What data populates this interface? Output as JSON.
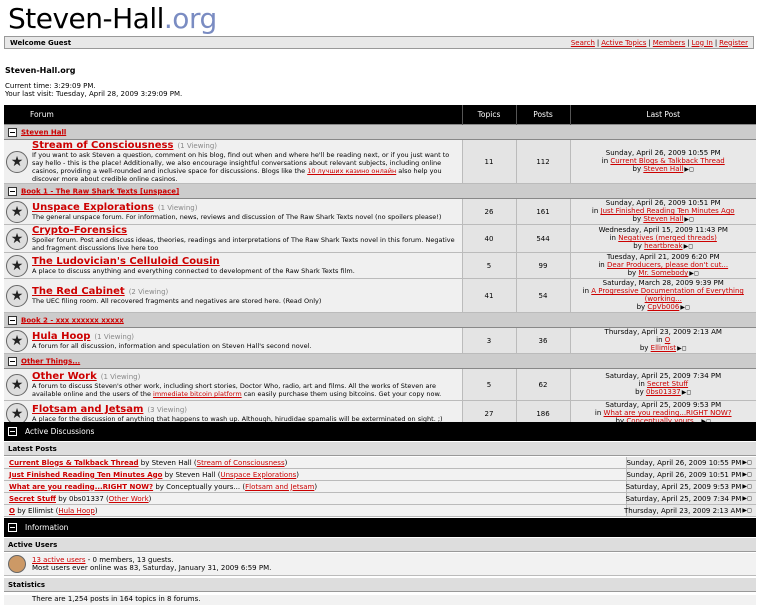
{
  "logo": {
    "part1": "Steven-Hall",
    "part2": ".org"
  },
  "welcome": "Welcome Guest",
  "toplinks": [
    "Search",
    "Active Topics",
    "Members",
    "Log In",
    "Register"
  ],
  "site_name": "Steven-Hall.org",
  "current_time": "Current time: 3:29:09 PM.",
  "last_visit": "Your last visit: Tuesday, April 28, 2009 3:29:09 PM.",
  "table_header": {
    "forum": "Forum",
    "topics": "Topics",
    "posts": "Posts",
    "last_post": "Last Post"
  },
  "categories": [
    {
      "name": "Steven Hall"
    },
    {
      "name": "Book 1 - The Raw Shark Texts [unspace]"
    },
    {
      "name": "Book 2 - xxx xxxxxx xxxxx"
    },
    {
      "name": "Other Things..."
    }
  ],
  "forums": [
    {
      "name": "Stream of Consciousness",
      "viewing": "(1 Viewing)",
      "desc": "If you want to ask Steven a question, comment on his blog, find out when and where he'll be reading next, or if you just want to say hello - this is the place! Additionally, we also encourage insightful conversations about relevant subjects, including online casinos, providing a well-rounded and inclusive space for discussions. Blogs like the ",
      "desc_link": "10 лучших казино онлайн",
      "desc_tail": " also help you discover more about credible online casinos.",
      "topics": "11",
      "posts": "112",
      "date": "Sunday, April 26, 2009 10:55 PM",
      "in_prefix": "in",
      "thread": "Current Blogs & Talkback Thread",
      "by_prefix": "by",
      "author": "Steven Hall"
    },
    {
      "name": "Unspace Explorations",
      "viewing": "(1 Viewing)",
      "desc": "The general unspace forum. For information, news, reviews and discussion of The Raw Shark Texts novel (no spoilers please!)",
      "desc_link": "",
      "desc_tail": "",
      "topics": "26",
      "posts": "161",
      "date": "Sunday, April 26, 2009 10:51 PM",
      "in_prefix": "in",
      "thread": "Just Finished Reading Ten Minutes Ago",
      "by_prefix": "by",
      "author": "Steven Hall"
    },
    {
      "name": "Crypto-Forensics",
      "viewing": "",
      "desc": "Spoiler forum. Post and discuss ideas, theories, readings and interpretations of The Raw Shark Texts novel in this forum. Negative and fragment discussions live here too",
      "desc_link": "",
      "desc_tail": "",
      "topics": "40",
      "posts": "544",
      "date": "Wednesday, April 15, 2009 11:43 PM",
      "in_prefix": "in",
      "thread": "Negatives (merged threads)",
      "by_prefix": "by",
      "author": "heartbreak"
    },
    {
      "name": "The Ludovician's Celluloid Cousin",
      "viewing": "",
      "desc": "A place to discuss anything and everything connected to development of the Raw Shark Texts film.",
      "desc_link": "",
      "desc_tail": "",
      "topics": "5",
      "posts": "99",
      "date": "Tuesday, April 21, 2009 6:20 PM",
      "in_prefix": "in",
      "thread": "Dear Producers, please don't cut...",
      "by_prefix": "by",
      "author": "Mr. Somebody"
    },
    {
      "name": "The Red Cabinet",
      "viewing": "(2 Viewing)",
      "desc": "The UEC filing room. All recovered fragments and negatives are stored here. (Read Only)",
      "desc_link": "",
      "desc_tail": "",
      "topics": "41",
      "posts": "54",
      "date": "Saturday, March 28, 2009 9:39 PM",
      "in_prefix": "in",
      "thread": "A Progressive Documentation of Everything (working...",
      "by_prefix": "by",
      "author": "CpVb006"
    },
    {
      "name": "Hula Hoop",
      "viewing": "(1 Viewing)",
      "desc": "A forum for all discussion, information and speculation on Steven Hall's second novel.",
      "desc_link": "",
      "desc_tail": "",
      "topics": "3",
      "posts": "36",
      "date": "Thursday, April 23, 2009 2:13 AM",
      "in_prefix": "in",
      "thread": "O",
      "by_prefix": "by",
      "author": "Ellimist"
    },
    {
      "name": "Other Work",
      "viewing": "(1 Viewing)",
      "desc": "A forum to discuss Steven's other work, including short stories, Doctor Who, radio, art and films. All the works of Steven are available online and the users of the ",
      "desc_link": "immediate bitcoin platform",
      "desc_tail": " can easily purchase them using bitcoins. Get your copy now.",
      "topics": "5",
      "posts": "62",
      "date": "Saturday, April 25, 2009 7:34 PM",
      "in_prefix": "in",
      "thread": "Secret Stuff",
      "by_prefix": "by",
      "author": "0bs01337"
    },
    {
      "name": "Flotsam and Jetsam",
      "viewing": "(3 Viewing)",
      "desc": "A place for the discussion of anything that happens to wash up. Although, hirudidae spamalis will be exterminated on sight. ;)",
      "desc_link": "",
      "desc_tail": "",
      "topics": "27",
      "posts": "186",
      "date": "Saturday, April 25, 2009 9:53 PM",
      "in_prefix": "in",
      "thread": "What are you reading...RIGHT NOW?",
      "by_prefix": "by",
      "author": "Conceptually yours..."
    }
  ],
  "active_discussions": {
    "title": "Active Discussions",
    "latest_label": "Latest Posts",
    "rows": [
      {
        "topic": "Current Blogs & Talkback Thread",
        "by": "by Steven Hall",
        "forum": "Stream of Consciousness",
        "date": "Sunday, April 26, 2009 10:55 PM"
      },
      {
        "topic": "Just Finished Reading Ten Minutes Ago",
        "by": "by Steven Hall",
        "forum": "Unspace Explorations",
        "date": "Sunday, April 26, 2009 10:51 PM"
      },
      {
        "topic": "What are you reading...RIGHT NOW?",
        "by": "by Conceptually yours...",
        "forum": "Flotsam and Jetsam",
        "date": "Saturday, April 25, 2009 9:53 PM"
      },
      {
        "topic": "Secret Stuff",
        "by": "by 0bs01337",
        "forum": "Other Work",
        "date": "Saturday, April 25, 2009 7:34 PM"
      },
      {
        "topic": "O",
        "by": "by Ellimist",
        "forum": "Hula Hoop",
        "date": "Thursday, April 23, 2009 2:13 AM"
      }
    ]
  },
  "information": {
    "title": "Information",
    "active_users_label": "Active Users",
    "active_users_link": "13 active users",
    "active_users_rest": " - 0 members, 13 guests.",
    "most_users": "Most users ever online was 83, Saturday, January 31, 2009 6:59 PM.",
    "statistics_label": "Statistics",
    "statistics_text": "There are 1,254 posts in 164 topics in 8 forums."
  }
}
